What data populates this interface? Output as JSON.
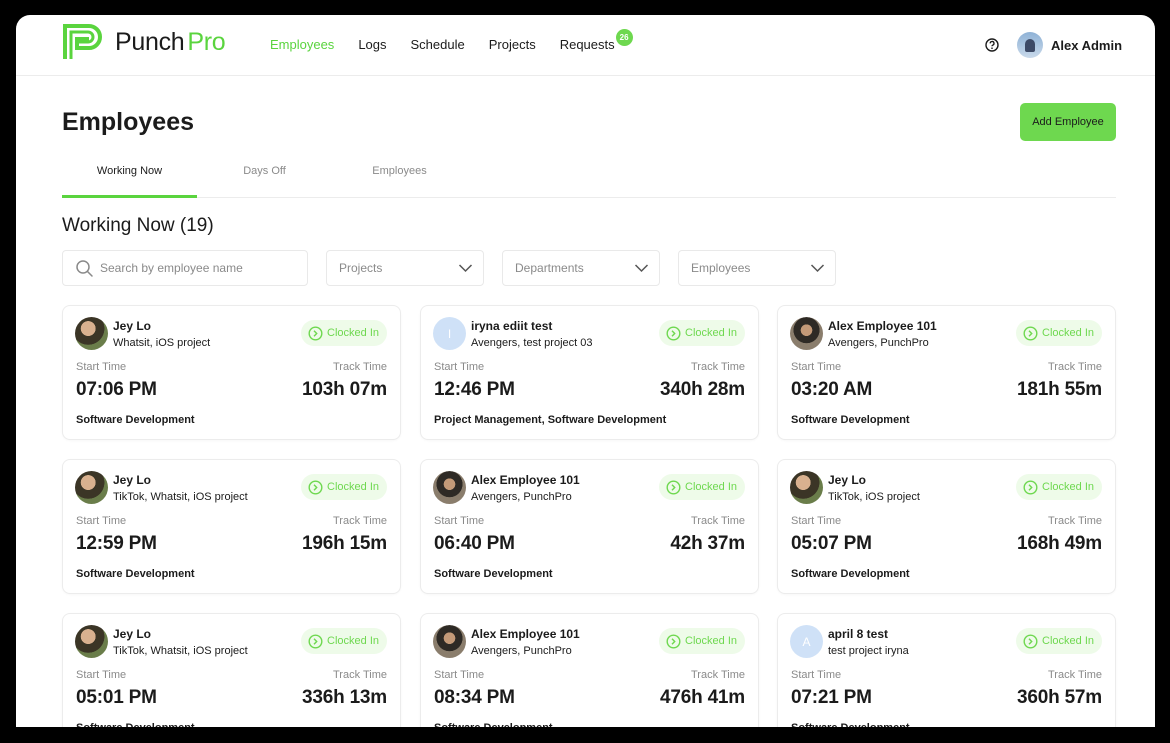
{
  "app": {
    "brand_punch": "Punch",
    "brand_pro": "Pro",
    "accent_color": "#6ed84f"
  },
  "nav": {
    "items": [
      {
        "label": "Employees",
        "active": true
      },
      {
        "label": "Logs"
      },
      {
        "label": "Schedule"
      },
      {
        "label": "Projects"
      },
      {
        "label": "Requests",
        "badge": "26"
      }
    ]
  },
  "user": {
    "name": "Alex Admin"
  },
  "page": {
    "title": "Employees",
    "add_button": "Add Employee",
    "tabs": [
      {
        "label": "Working Now",
        "active": true
      },
      {
        "label": "Days Off"
      },
      {
        "label": "Employees"
      }
    ],
    "section_title": "Working Now (19)"
  },
  "filters": {
    "search_placeholder": "Search by employee name",
    "projects": "Projects",
    "departments": "Departments",
    "employees": "Employees"
  },
  "card_labels": {
    "start_time": "Start Time",
    "track_time": "Track Time",
    "status": "Clocked In"
  },
  "cards": [
    {
      "name": "Jey Lo",
      "projects": "Whatsit, iOS project",
      "start": "07:06 PM",
      "track": "103h 07m",
      "dept": "Software Development",
      "avatar": "photo-a"
    },
    {
      "name": "iryna ediit test",
      "projects": "Avengers, test project 03",
      "start": "12:46 PM",
      "track": "340h 28m",
      "dept": "Project Management, Software Development",
      "avatar": "initial",
      "initial": "I"
    },
    {
      "name": "Alex Employee 101",
      "projects": "Avengers, PunchPro",
      "start": "03:20 AM",
      "track": "181h 55m",
      "dept": "Software Development",
      "avatar": "photo-b"
    },
    {
      "name": "Jey Lo",
      "projects": "TikTok, Whatsit, iOS project",
      "start": "12:59 PM",
      "track": "196h 15m",
      "dept": "Software Development",
      "avatar": "photo-a"
    },
    {
      "name": "Alex Employee 101",
      "projects": "Avengers, PunchPro",
      "start": "06:40 PM",
      "track": "42h 37m",
      "dept": "Software Development",
      "avatar": "photo-b"
    },
    {
      "name": "Jey Lo",
      "projects": "TikTok, iOS project",
      "start": "05:07 PM",
      "track": "168h 49m",
      "dept": "Software Development",
      "avatar": "photo-a"
    },
    {
      "name": "Jey Lo",
      "projects": "TikTok, Whatsit, iOS project",
      "start": "05:01 PM",
      "track": "336h 13m",
      "dept": "Software Development",
      "avatar": "photo-a"
    },
    {
      "name": "Alex Employee 101",
      "projects": "Avengers, PunchPro",
      "start": "08:34 PM",
      "track": "476h 41m",
      "dept": "Software Development",
      "avatar": "photo-b"
    },
    {
      "name": "april 8 test",
      "projects": "test project iryna",
      "start": "07:21 PM",
      "track": "360h 57m",
      "dept": "Software Development",
      "avatar": "initial",
      "initial": "A"
    }
  ]
}
